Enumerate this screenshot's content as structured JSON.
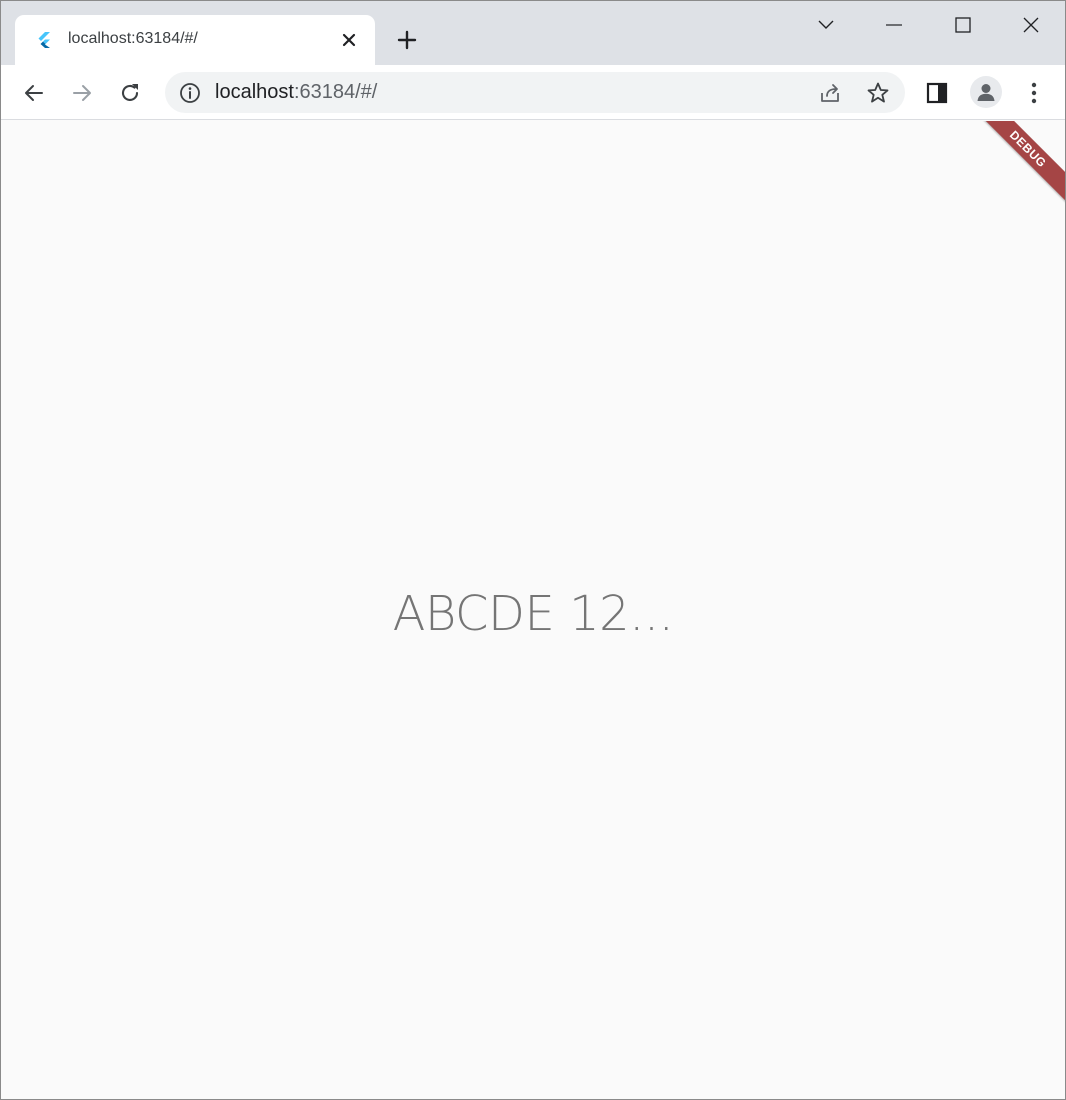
{
  "tab": {
    "title": "localhost:63184/#/",
    "favicon": "flutter-icon"
  },
  "omnibox": {
    "host": "localhost",
    "rest": ":63184/#/"
  },
  "content": {
    "center_text": "ABCDE 12...",
    "debug_banner": "DEBUG"
  },
  "colors": {
    "tabstrip": "#dee1e6",
    "debug_banner": "#a54545",
    "content_bg": "#fafafa",
    "text": "#757575"
  }
}
